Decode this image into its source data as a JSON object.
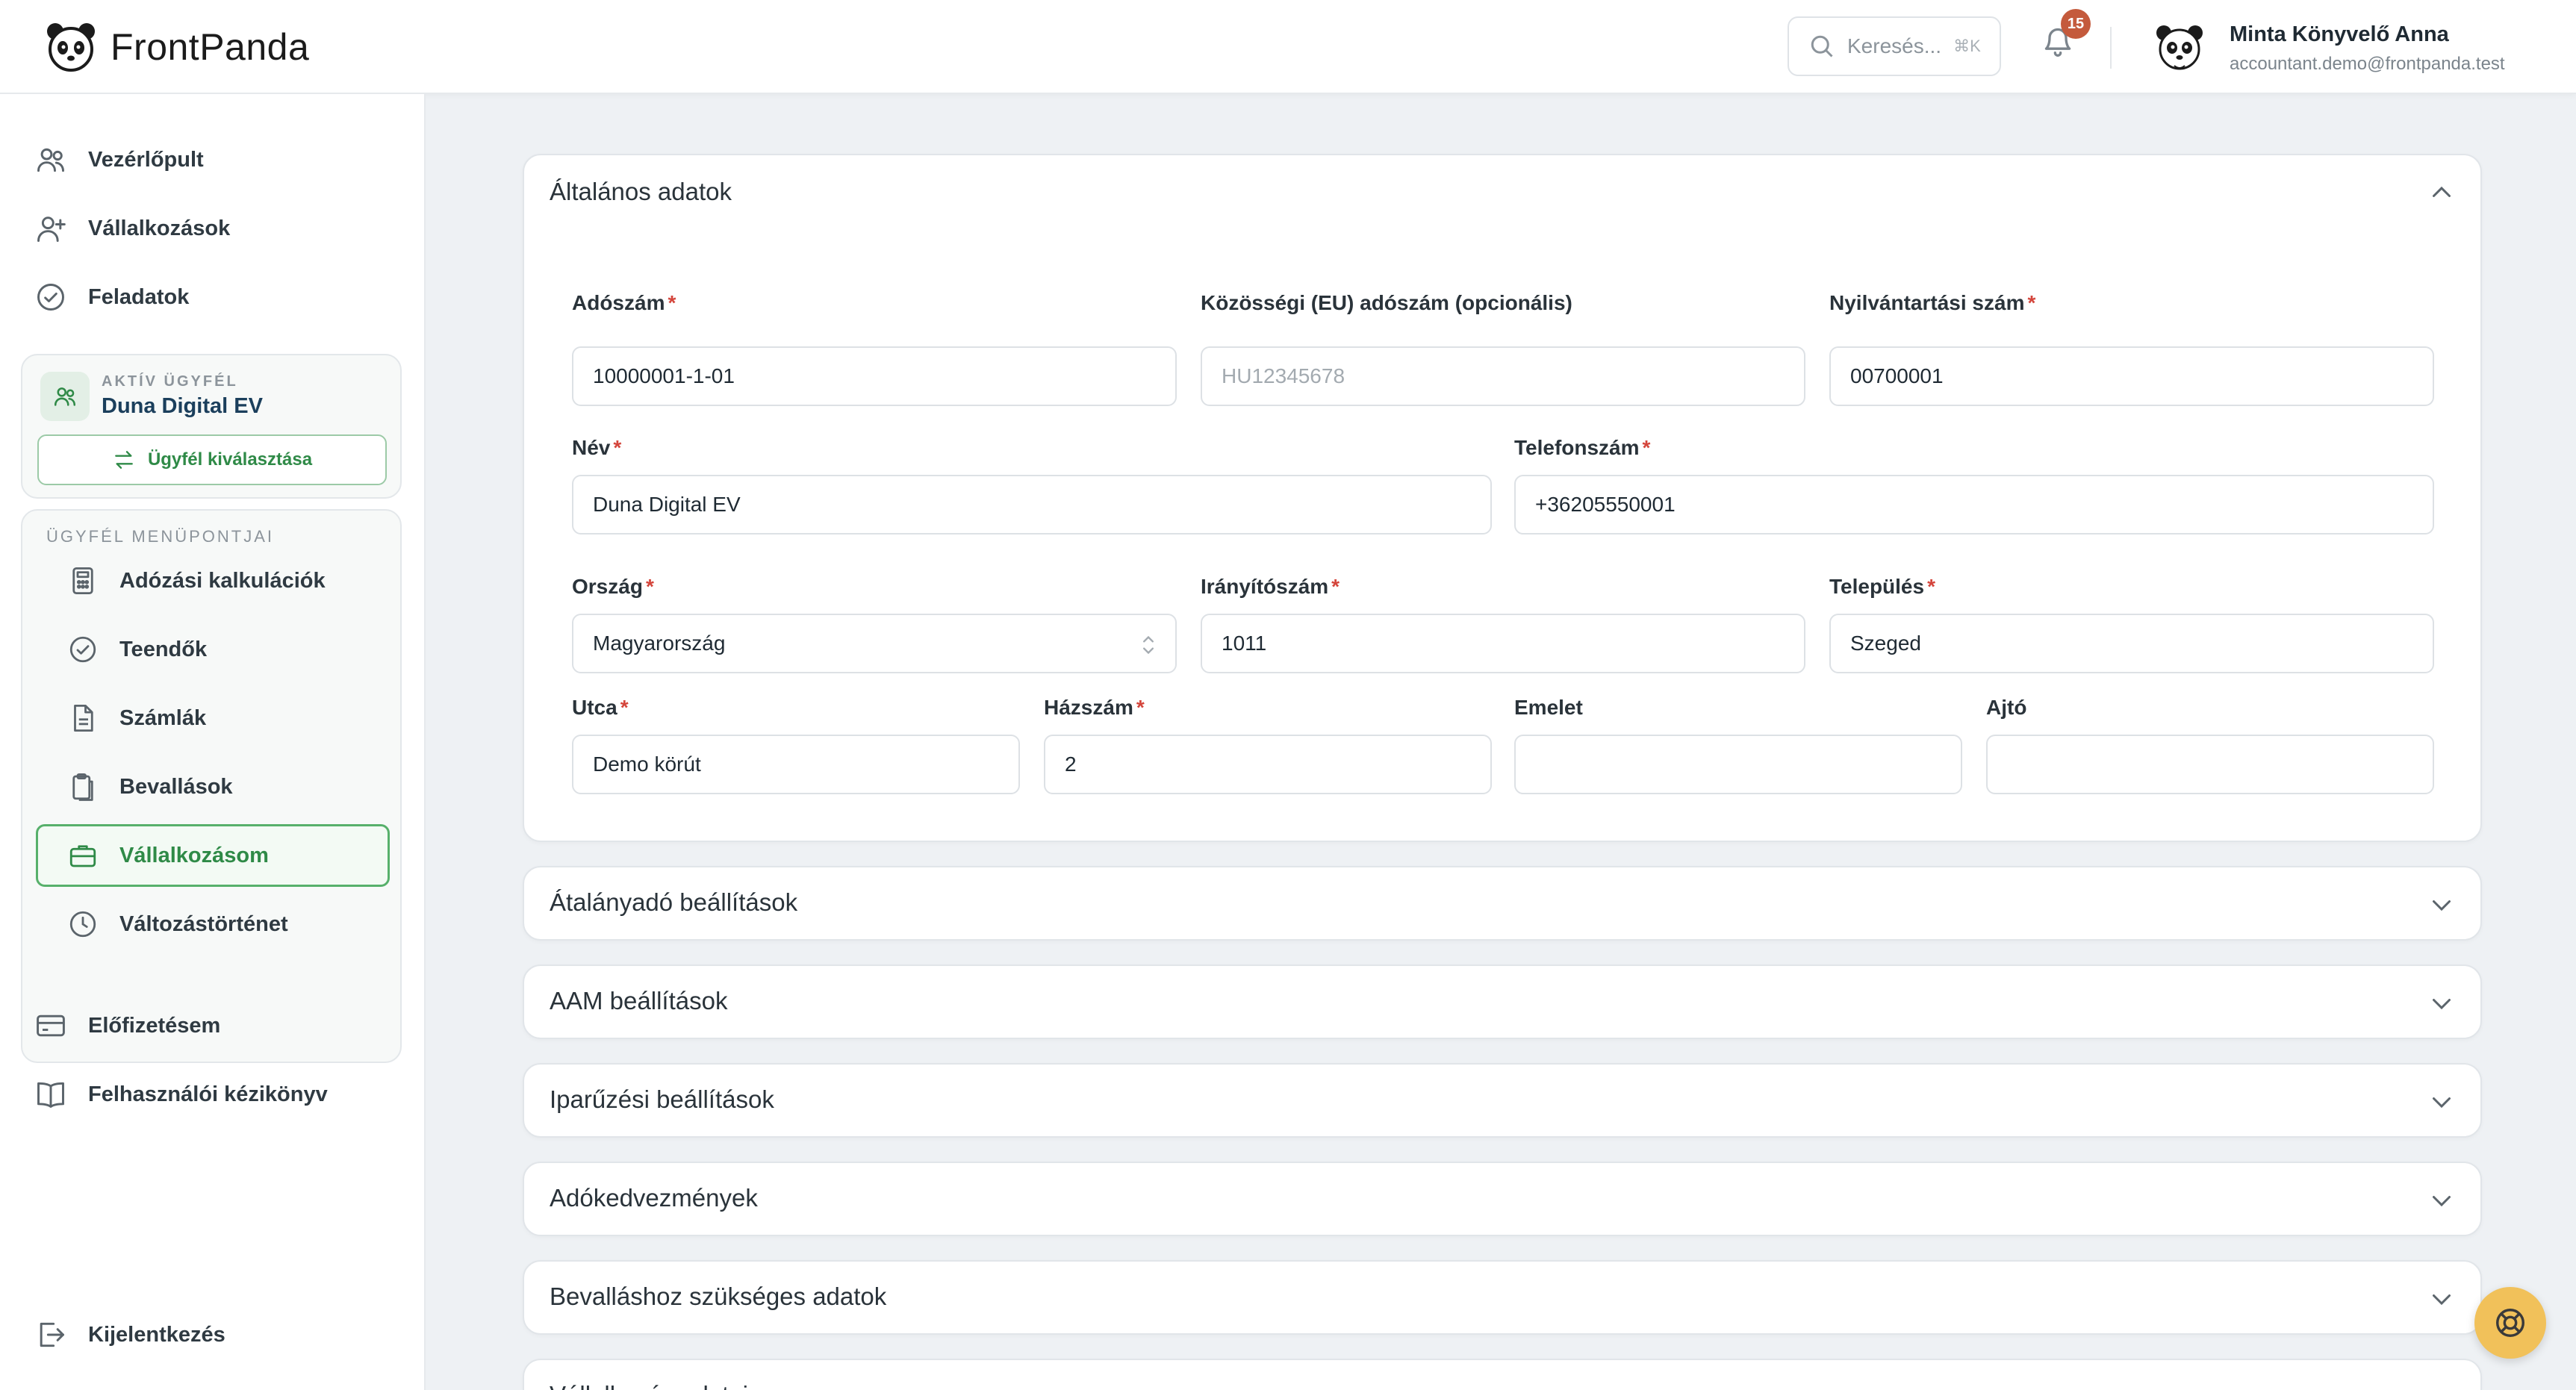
{
  "app": {
    "brand": "FrontPanda",
    "search_placeholder": "Keresés...",
    "search_shortcut": "⌘K",
    "notification_count": "15",
    "user_name": "Minta Könyvelő Anna",
    "user_email": "accountant.demo@frontpanda.test"
  },
  "sidebar": {
    "top_items": [
      {
        "label": "Vezérlőpult",
        "icon": "users-icon"
      },
      {
        "label": "Vállalkozások",
        "icon": "user-plus-icon"
      },
      {
        "label": "Feladatok",
        "icon": "check-circle-icon"
      }
    ],
    "active_client_label": "AKTÍV ÜGYFÉL",
    "active_client_name": "Duna Digital EV",
    "select_client_button": "Ügyfél kiválasztása",
    "client_menu_label": "ÜGYFÉL MENÜPONTJAI",
    "client_menu_items": [
      {
        "label": "Adózási kalkulációk",
        "icon": "calculator-icon"
      },
      {
        "label": "Teendők",
        "icon": "check-circle-icon"
      },
      {
        "label": "Számlák",
        "icon": "document-icon"
      },
      {
        "label": "Bevallások",
        "icon": "clipboard-icon"
      },
      {
        "label": "Vállalkozásom",
        "icon": "briefcase-icon",
        "active": true
      },
      {
        "label": "Változástörténet",
        "icon": "clock-icon"
      }
    ],
    "bottom_items": [
      {
        "label": "Előfizetésem",
        "icon": "credit-card-icon"
      },
      {
        "label": "Felhasználói kézikönyv",
        "icon": "book-icon"
      }
    ],
    "logout": "Kijelentkezés"
  },
  "general": {
    "title": "Általános adatok",
    "fields": {
      "tax_number": {
        "label": "Adószám",
        "value": "10000001-1-01"
      },
      "eu_tax_number": {
        "label": "Közösségi (EU) adószám (opcionális)",
        "placeholder": "HU12345678"
      },
      "registration_number": {
        "label": "Nyilvántartási szám",
        "value": "00700001"
      },
      "name": {
        "label": "Név",
        "value": "Duna Digital EV"
      },
      "phone": {
        "label": "Telefonszám",
        "value": "+36205550001"
      },
      "country": {
        "label": "Ország",
        "value": "Magyarország"
      },
      "zip": {
        "label": "Irányítószám",
        "value": "1011"
      },
      "city": {
        "label": "Település",
        "value": "Szeged"
      },
      "street": {
        "label": "Utca",
        "value": "Demo körút"
      },
      "house_number": {
        "label": "Házszám",
        "value": "2"
      },
      "floor": {
        "label": "Emelet",
        "value": ""
      },
      "door": {
        "label": "Ajtó",
        "value": ""
      }
    }
  },
  "sections": [
    {
      "title": "Átalányadó beállítások"
    },
    {
      "title": "AAM beállítások"
    },
    {
      "title": "Iparűzési beállítások"
    },
    {
      "title": "Adókedvezmények"
    },
    {
      "title": "Bevalláshoz szükséges adatok"
    },
    {
      "title": "Vállalkozás adatai"
    }
  ]
}
